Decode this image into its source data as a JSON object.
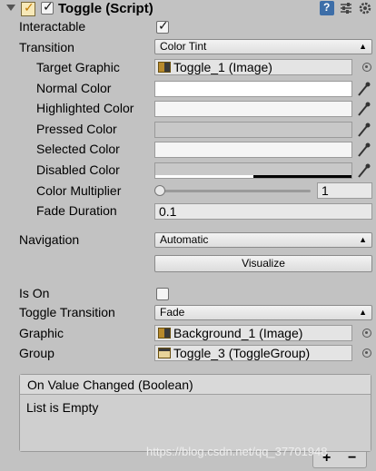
{
  "component": {
    "title": "Toggle (Script)",
    "enabled": true,
    "icons": [
      "help-book-icon",
      "preset-sliders-icon",
      "settings-gear-icon"
    ]
  },
  "fields": {
    "interactable": {
      "label": "Interactable",
      "checked": true
    },
    "transition": {
      "label": "Transition",
      "value": "Color Tint"
    },
    "target_graphic": {
      "label": "Target Graphic",
      "value": "Toggle_1 (Image)"
    },
    "normal_color": {
      "label": "Normal Color",
      "color": "#ffffff"
    },
    "highlighted_color": {
      "label": "Highlighted Color",
      "color": "#f5f5f5"
    },
    "pressed_color": {
      "label": "Pressed Color",
      "color": "#c8c8c8"
    },
    "selected_color": {
      "label": "Selected Color",
      "color": "#f5f5f5"
    },
    "disabled_color": {
      "label": "Disabled Color",
      "color": "#c8c8c8"
    },
    "color_multiplier": {
      "label": "Color Multiplier",
      "value": "1",
      "slider_fraction": 0.0
    },
    "fade_duration": {
      "label": "Fade Duration",
      "value": "0.1"
    },
    "navigation": {
      "label": "Navigation",
      "value": "Automatic"
    },
    "visualize": {
      "label": "Visualize"
    },
    "is_on": {
      "label": "Is On",
      "checked": false
    },
    "toggle_transition": {
      "label": "Toggle Transition",
      "value": "Fade"
    },
    "graphic": {
      "label": "Graphic",
      "value": "Background_1 (Image)"
    },
    "group": {
      "label": "Group",
      "value": "Toggle_3 (ToggleGroup)"
    }
  },
  "event": {
    "title": "On Value Changed (Boolean)",
    "empty_text": "List is Empty",
    "add": "+",
    "remove": "−"
  },
  "watermark": "https://blog.csdn.net/qq_37701948"
}
